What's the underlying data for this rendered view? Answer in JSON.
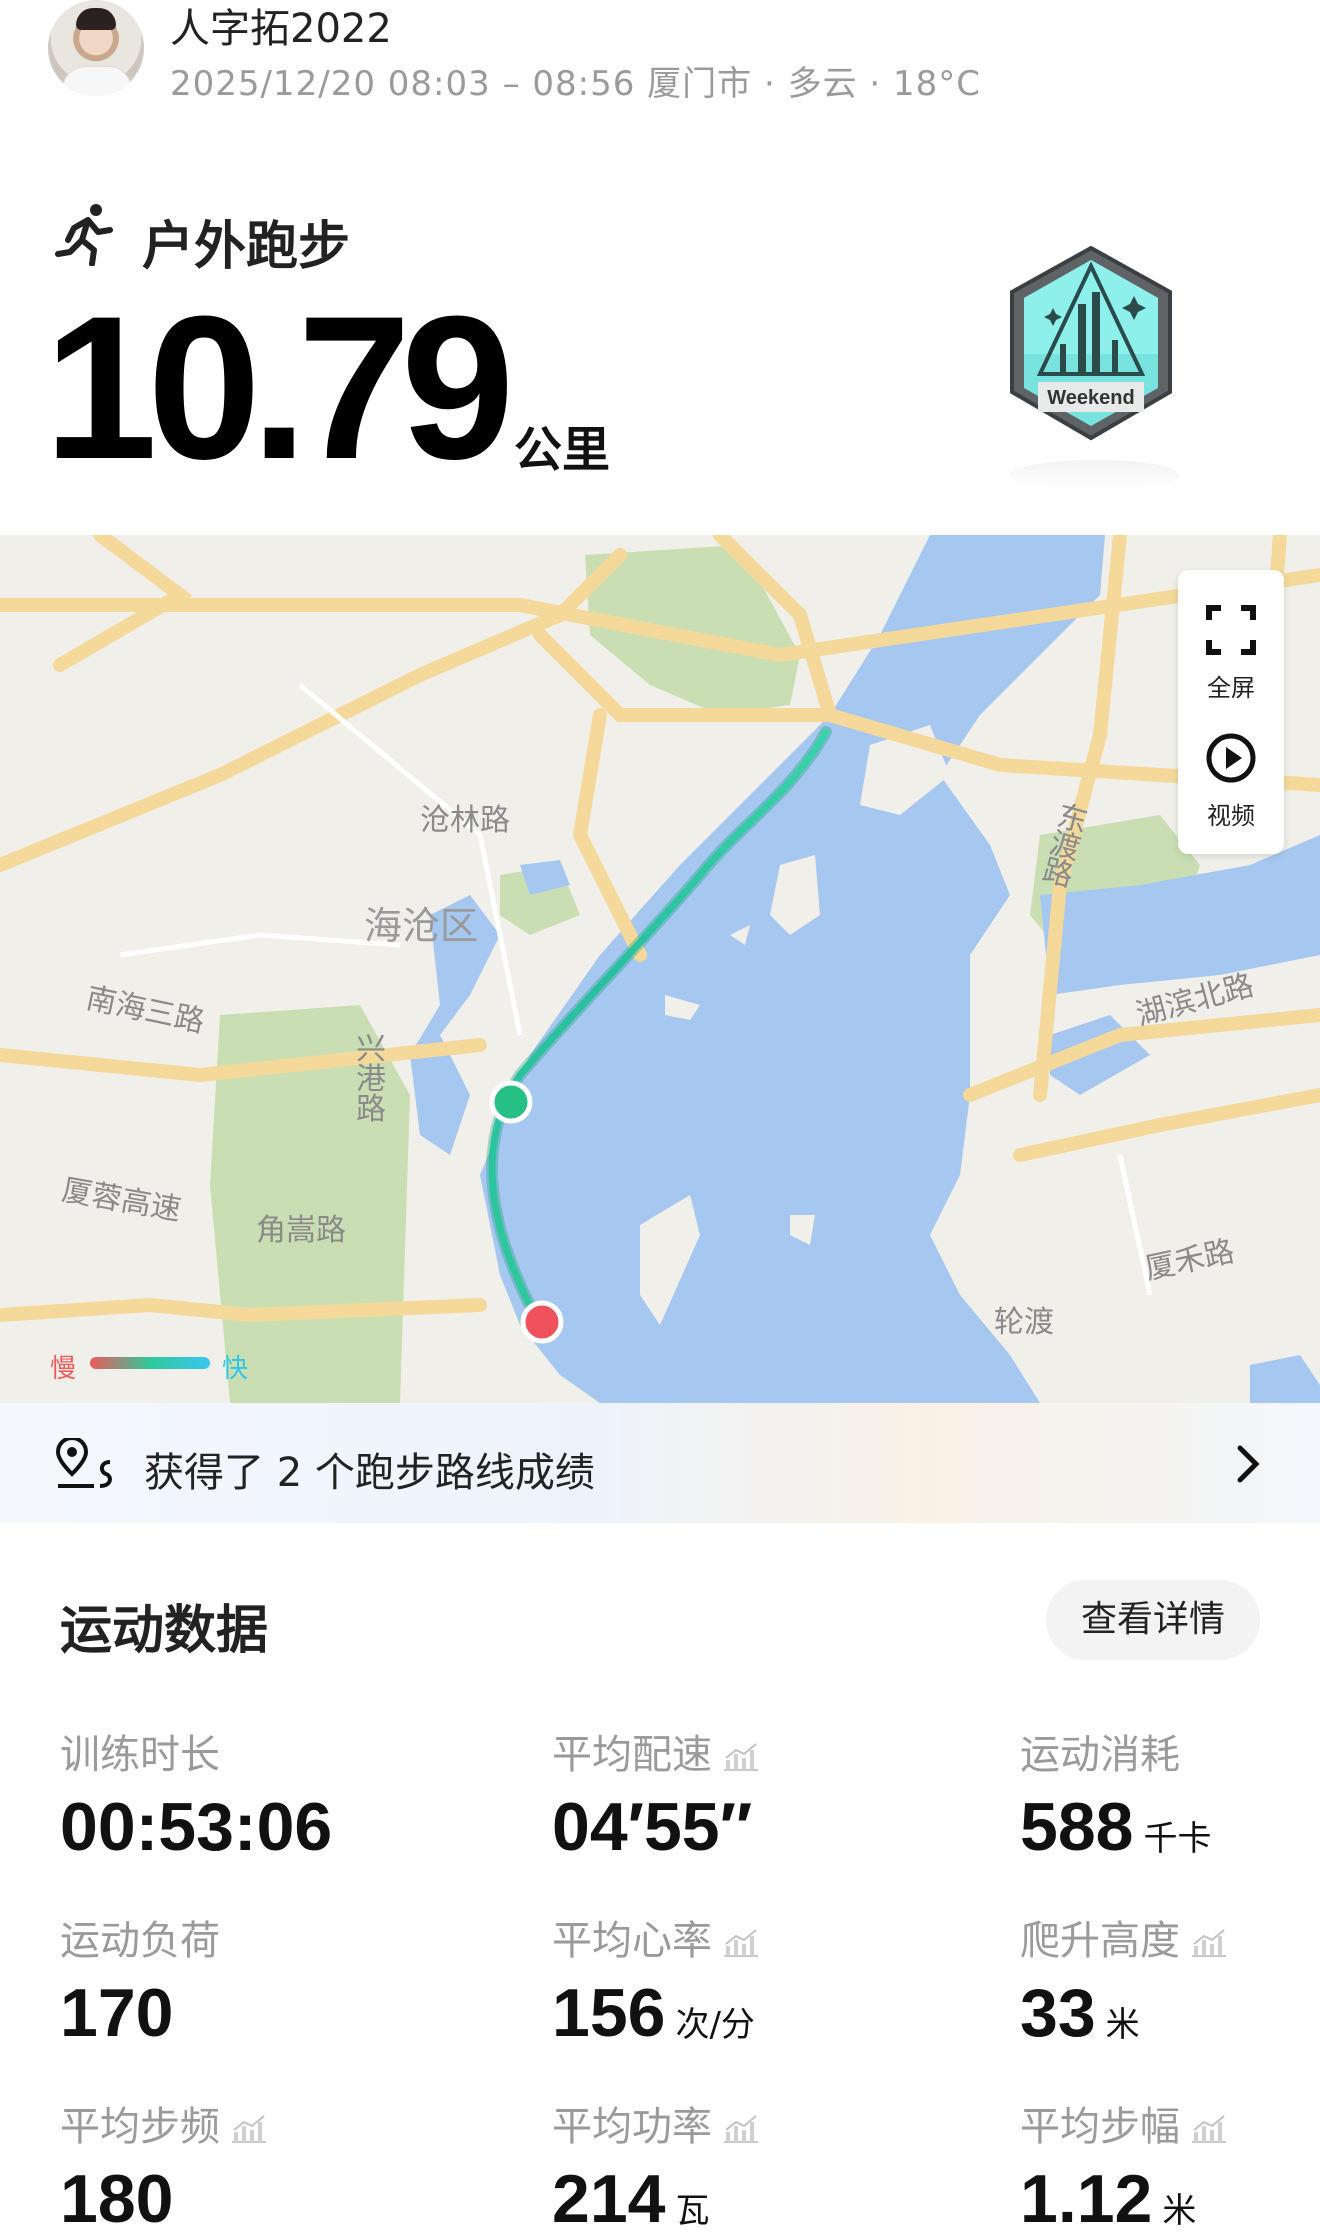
{
  "header": {
    "username": "人字拓2022",
    "meta": "2025/12/20 08:03 – 08:56 厦门市 · 多云 · 18°C"
  },
  "activity": {
    "type": "户外跑步",
    "distance": "10.79",
    "distance_unit": "公里",
    "badge_text": "Weekend"
  },
  "map": {
    "labels": {
      "canglin_rd": "沧林路",
      "haicang": "海沧区",
      "nanhai3": "南海三路",
      "xinggang": "兴港路",
      "xiarong": "厦蓉高速",
      "jiaosong": "角嵩路",
      "dongdu": "东渡路",
      "hubin": "湖滨北路",
      "xiahe": "厦禾路",
      "ferry": "轮渡"
    },
    "controls": {
      "fullscreen": "全屏",
      "video": "视频"
    },
    "legend": {
      "slow": "慢",
      "fast": "快"
    },
    "colors": {
      "water": "#a6c8f0",
      "road": "#f4d99a",
      "green": "#c9dfb3",
      "route": "#2fc89c",
      "start": "#27c084",
      "end": "#f0525d"
    }
  },
  "achievement": {
    "text": "获得了 2 个跑步路线成绩"
  },
  "stats": {
    "title": "运动数据",
    "detail_button": "查看详情",
    "items": [
      {
        "label": "训练时长",
        "value": "00:53:06",
        "unit": ""
      },
      {
        "label": "平均配速",
        "value": "04′55″",
        "unit": ""
      },
      {
        "label": "运动消耗",
        "value": "588",
        "unit": "千卡"
      },
      {
        "label": "运动负荷",
        "value": "170",
        "unit": ""
      },
      {
        "label": "平均心率",
        "value": "156",
        "unit": "次/分"
      },
      {
        "label": "爬升高度",
        "value": "33",
        "unit": "米"
      },
      {
        "label": "平均步频",
        "value": "180",
        "unit": ""
      },
      {
        "label": "平均功率",
        "value": "214",
        "unit": "瓦"
      },
      {
        "label": "平均步幅",
        "value": "1.12",
        "unit": "米"
      }
    ]
  }
}
